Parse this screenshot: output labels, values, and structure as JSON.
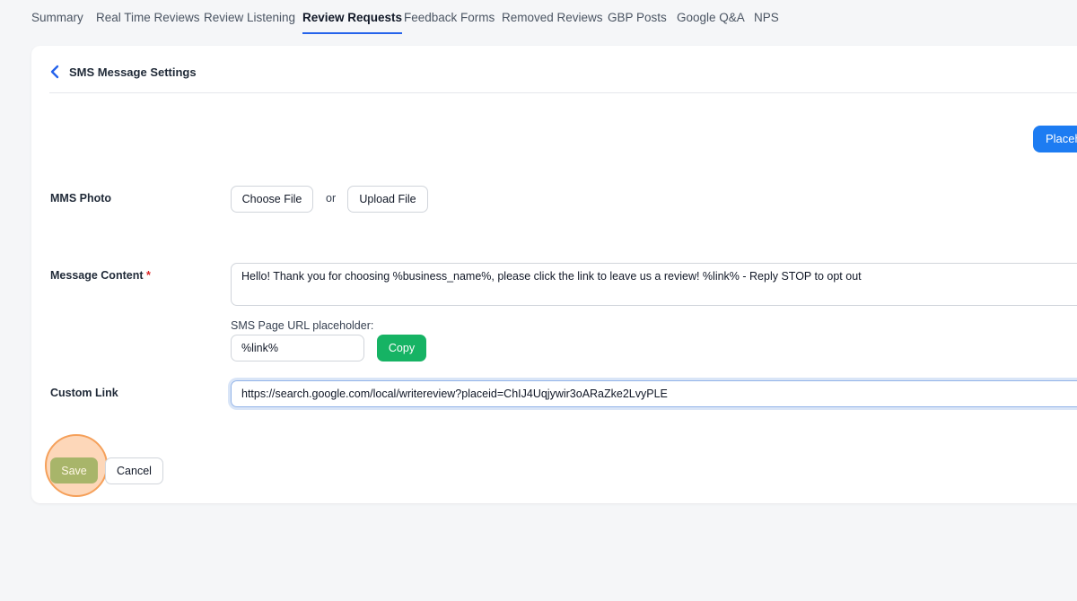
{
  "tabs": [
    {
      "label": "Summary",
      "active": false
    },
    {
      "label": "Real Time Reviews",
      "active": false
    },
    {
      "label": "Review Listening",
      "active": false
    },
    {
      "label": "Review Requests",
      "active": true
    },
    {
      "label": "Feedback Forms",
      "active": false
    },
    {
      "label": "Removed Reviews",
      "active": false
    },
    {
      "label": "GBP Posts",
      "active": false
    },
    {
      "label": "Google Q&A",
      "active": false
    },
    {
      "label": "NPS",
      "active": false
    }
  ],
  "header": {
    "title": "SMS Message Settings",
    "back_icon": "chevron-left-icon"
  },
  "placeholder_button": "Placeh",
  "mms": {
    "label": "MMS Photo",
    "choose_file": "Choose File",
    "or": "or",
    "upload_file": "Upload File"
  },
  "message": {
    "label": "Message Content",
    "required_mark": "*",
    "content": "Hello! Thank you for choosing %business_name%, please click the link to leave us a review! %link% - Reply STOP to opt out",
    "url_placeholder_label": "SMS Page URL placeholder:",
    "url_placeholder_value": "%link%",
    "copy": "Copy"
  },
  "custom_link": {
    "label": "Custom Link",
    "value": "https://search.google.com/local/writereview?placeid=ChIJ4Uqjywir3oARaZke2LvyPLE"
  },
  "actions": {
    "save": "Save",
    "cancel": "Cancel"
  },
  "colors": {
    "accent": "#1d7cf2",
    "copy_green": "#16b364",
    "required_red": "#dc2626",
    "highlight_ring": "#f5a05a"
  }
}
